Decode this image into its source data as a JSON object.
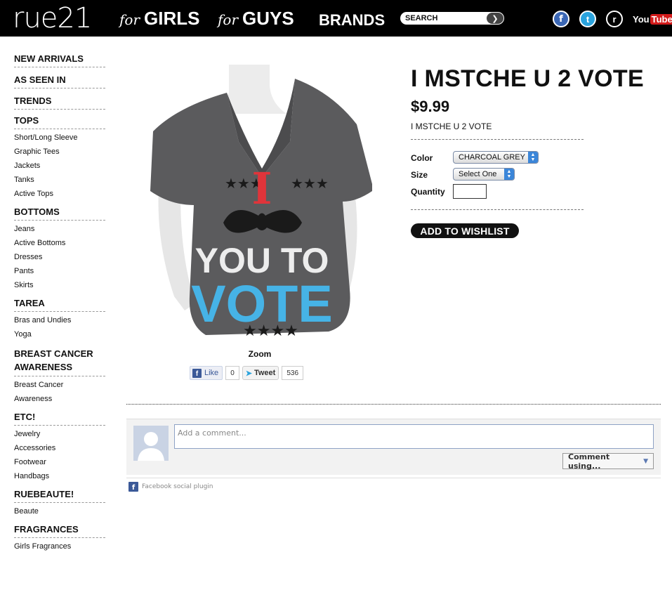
{
  "header": {
    "logo": "rue21",
    "nav": [
      {
        "prefix": "for",
        "label": "GIRLS"
      },
      {
        "prefix": "for",
        "label": "GUYS"
      },
      {
        "prefix": "",
        "label": "BRANDS"
      }
    ],
    "search_placeholder": "SEARCH",
    "social": {
      "facebook_glyph": "f",
      "twitter_glyph": "t",
      "r_glyph": "r",
      "youtube_you": "You",
      "youtube_tube": "Tube"
    }
  },
  "sidebar": [
    {
      "heading": "NEW ARRIVALS",
      "links": []
    },
    {
      "heading": "AS SEEN IN",
      "links": []
    },
    {
      "heading": "TRENDS",
      "links": []
    },
    {
      "heading": "TOPS",
      "links": [
        "Short/Long Sleeve",
        "Graphic Tees",
        "Jackets",
        "Tanks",
        "Active Tops"
      ]
    },
    {
      "heading": "BOTTOMS",
      "links": [
        "Jeans",
        "Active Bottoms",
        "Dresses",
        "Pants",
        "Skirts"
      ]
    },
    {
      "heading": "TAREA",
      "links": [
        "Bras and Undies",
        "Yoga"
      ]
    },
    {
      "heading": "BREAST CANCER AWARENESS",
      "links": [
        "Breast Cancer",
        "Awareness"
      ]
    },
    {
      "heading": "ETC!",
      "links": [
        "Jewelry",
        "Accessories",
        "Footwear",
        "Handbags"
      ]
    },
    {
      "heading": "RUEBEAUTE!",
      "links": [
        "Beaute"
      ]
    },
    {
      "heading": "FRAGRANCES",
      "links": [
        "Girls Fragrances"
      ]
    }
  ],
  "product": {
    "title": "I MSTCHE U 2 VOTE",
    "price": "$9.99",
    "subtitle": "I MSTCHE U 2 VOTE",
    "color_label": "Color",
    "color_value": "CHARCOAL GREY",
    "size_label": "Size",
    "size_value": "Select One",
    "quantity_label": "Quantity",
    "quantity_value": "",
    "wishlist_button": "ADD TO WISHLIST",
    "zoom_label": "Zoom",
    "shirt_text": {
      "big_letter": "I",
      "line1": "YOU TO",
      "line2": "VOTE"
    }
  },
  "share": {
    "like_label": "Like",
    "like_count": "0",
    "tweet_label": "Tweet",
    "tweet_count": "536"
  },
  "comments": {
    "placeholder": "Add a comment...",
    "comment_using": "Comment using...",
    "plugin_label": "Facebook social plugin"
  },
  "colors": {
    "header_bg": "#000000",
    "shirt": "#5b5b5d",
    "shirt_red": "#e0343a",
    "shirt_blue": "#46b3e6",
    "fb_blue": "#3b5998"
  }
}
